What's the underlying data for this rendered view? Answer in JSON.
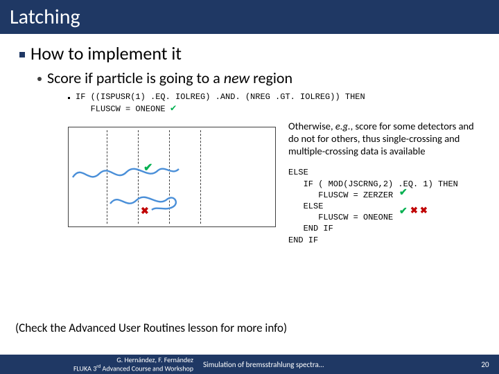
{
  "title": "Latching",
  "heading": "How to implement it",
  "subheading_pre": "Score if particle is going to a ",
  "subheading_em": "new",
  "subheading_post": " region",
  "code_line1": "IF ((ISPUSR(1) .EQ. IOLREG) .AND. (NREG .GT. IOLREG)) THEN",
  "code_line2": "   FLUSCW = ONEONE",
  "para1_pre": "Otherwise, ",
  "para1_em": "e.g.",
  "para1_post": ", score for some detectors and do not for others, thus single-crossing and multiple-crossing data is available",
  "code2": "ELSE\n   IF ( MOD(JSCRNG,2) .EQ. 1) THEN\n      FLUSCW = ZERZER\n   ELSE\n      FLUSCW = ONEONE\n   END IF\nEND IF",
  "footer_note": "(Check the Advanced User Routines lesson for more info)",
  "footer_authors": "G. Hernández, F. Fernández",
  "footer_course_pre": "FLUKA 3",
  "footer_course_sup": "rd",
  "footer_course_post": " Advanced Course and Workshop",
  "footer_mid": "Simulation of bremsstrahlung spectra…",
  "page_num": "20"
}
